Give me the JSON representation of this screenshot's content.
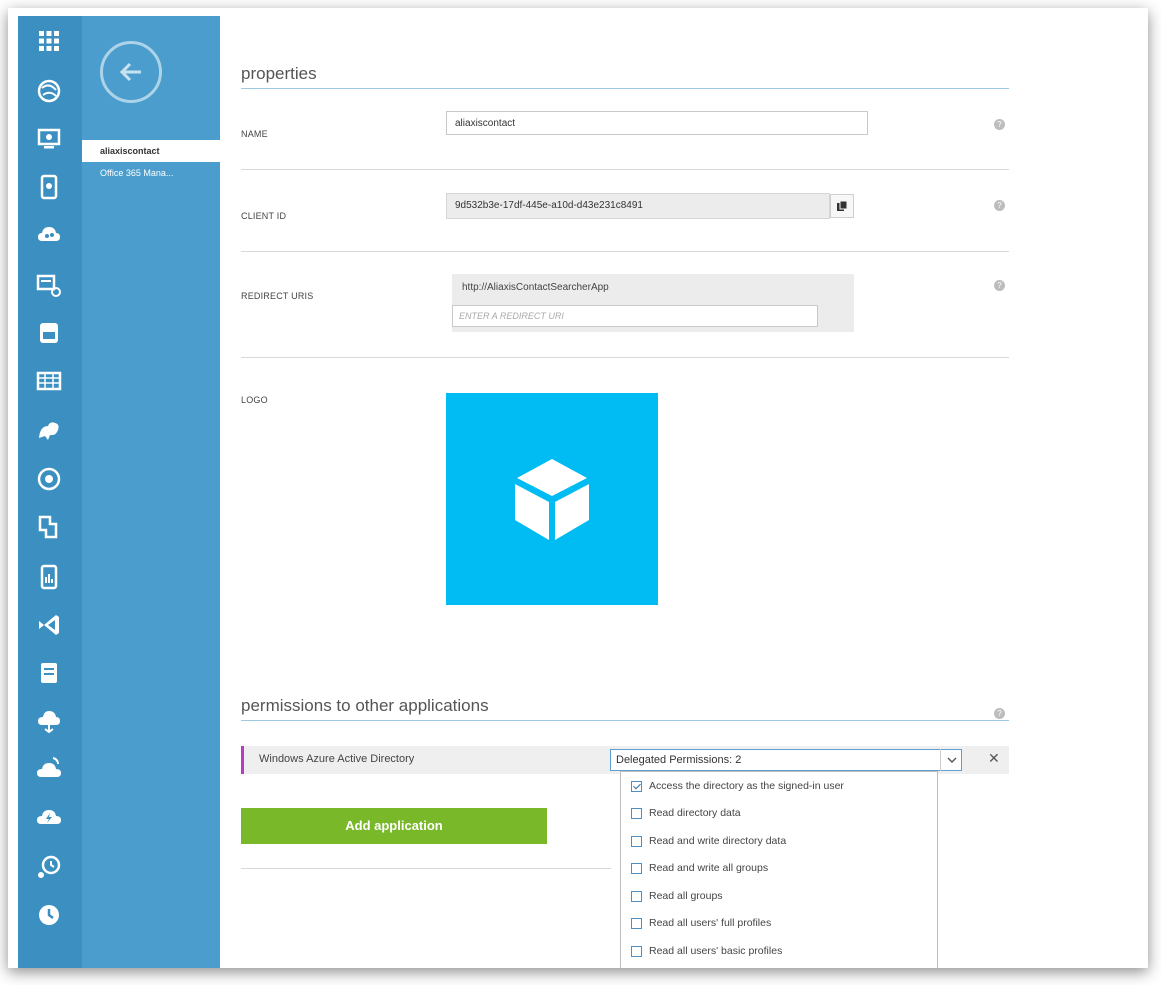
{
  "rail": {
    "icons": [
      "all-items-icon",
      "websites-icon",
      "virtual-machines-icon",
      "mobile-services-icon",
      "cloud-services-icon",
      "batch-icon",
      "sql-databases-icon",
      "storage-icon",
      "hdinsight-icon",
      "media-services-icon",
      "service-bus-icon",
      "mobile-engagement-icon",
      "visual-studio-icon",
      "cache-icon",
      "biztalk-icon",
      "recovery-services-icon",
      "cdn-icon",
      "automation-icon",
      "scheduler-icon"
    ]
  },
  "subnav": {
    "items": [
      {
        "label": "aliaxiscontact",
        "active": true
      },
      {
        "label": "Office 365 Mana...",
        "active": false
      }
    ]
  },
  "properties": {
    "title": "properties",
    "name_label": "NAME",
    "name_value": "aliaxiscontact",
    "client_id_label": "CLIENT ID",
    "client_id_value": "9d532b3e-17df-445e-a10d-d43e231c8491",
    "redirect_label": "REDIRECT URIS",
    "redirect_value": "http://AliaxisContactSearcherApp",
    "redirect_placeholder": "ENTER A REDIRECT URI",
    "logo_label": "LOGO"
  },
  "permissions": {
    "title": "permissions to other applications",
    "app_name": "Windows Azure Active Directory",
    "select_value": "Delegated Permissions: 2",
    "remove_label": "✕",
    "options": [
      {
        "label": "Access the directory as the signed-in user",
        "checked": true
      },
      {
        "label": "Read directory data",
        "checked": false
      },
      {
        "label": "Read and write directory data",
        "checked": false
      },
      {
        "label": "Read and write all groups",
        "checked": false
      },
      {
        "label": "Read all groups",
        "checked": false
      },
      {
        "label": "Read all users' full profiles",
        "checked": false
      },
      {
        "label": "Read all users' basic profiles",
        "checked": false
      }
    ]
  },
  "actions": {
    "add_application": "Add application"
  },
  "colors": {
    "rail": "#3b8fc1",
    "subnav": "#4a9dcc",
    "logo_tile": "#00bcf2",
    "add_button": "#79b829",
    "permission_marker": "#b83bc7"
  }
}
